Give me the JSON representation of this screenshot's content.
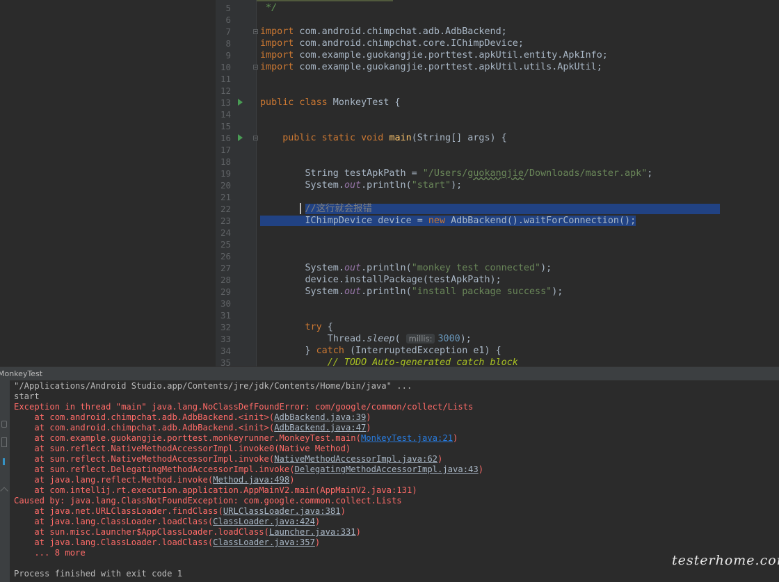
{
  "editor": {
    "lines": [
      {
        "num": "5",
        "html": "<span class=\"dcmt\"> */</span>"
      },
      {
        "num": "6",
        "html": ""
      },
      {
        "num": "7",
        "html": "<span class=\"kw\">import</span> com.android.chimpchat.adb.AdbBackend;",
        "fold": true
      },
      {
        "num": "8",
        "html": "<span class=\"kw\">import</span> com.android.chimpchat.core.IChimpDevice;"
      },
      {
        "num": "9",
        "html": "<span class=\"kw\">import</span> com.example.guokangjie.porttest.apkUtil.entity.ApkInfo;"
      },
      {
        "num": "10",
        "html": "<span class=\"kw\">import</span> com.example.guokangjie.porttest.apkUtil.utils.ApkUtil;",
        "fold": true
      },
      {
        "num": "11",
        "html": ""
      },
      {
        "num": "12",
        "html": ""
      },
      {
        "num": "13",
        "html": "<span class=\"kw\">public class</span> MonkeyTest {",
        "run": true
      },
      {
        "num": "14",
        "html": ""
      },
      {
        "num": "15",
        "html": ""
      },
      {
        "num": "16",
        "html": "    <span class=\"kw\">public static void</span> <span class=\"fn\">main</span>(String[] args) {",
        "run": true,
        "fold": true
      },
      {
        "num": "17",
        "html": ""
      },
      {
        "num": "18",
        "html": ""
      },
      {
        "num": "19",
        "html": "        String testApkPath = <span class=\"str\">\"/Users/<span class=\"squiggle\">guokangjie</span>/Downloads/master.apk\"</span>;"
      },
      {
        "num": "20",
        "html": "        System.<span class=\"fld\">out</span>.println(<span class=\"str\">\"start\"</span>);"
      },
      {
        "num": "21",
        "html": ""
      },
      {
        "num": "22",
        "html": "        <span class=\"sel\"><span class=\"cmt\">//这行就会报错</span>                                                              </span>",
        "selected": true
      },
      {
        "num": "23",
        "html": "<span class=\"sel\">        IChimpDevice device = <span class=\"kw\">new</span> AdbBackend().waitForConnection();</span>",
        "selected": true
      },
      {
        "num": "24",
        "html": ""
      },
      {
        "num": "25",
        "html": ""
      },
      {
        "num": "26",
        "html": ""
      },
      {
        "num": "27",
        "html": "        System.<span class=\"fld\">out</span>.println(<span class=\"str\">\"monkey test connected\"</span>);"
      },
      {
        "num": "28",
        "html": "        device.installPackage(testApkPath);"
      },
      {
        "num": "29",
        "html": "        System.<span class=\"fld\">out</span>.println(<span class=\"str\">\"install package success\"</span>);"
      },
      {
        "num": "30",
        "html": ""
      },
      {
        "num": "31",
        "html": ""
      },
      {
        "num": "32",
        "html": "        <span class=\"kw\">try</span> {"
      },
      {
        "num": "33",
        "html": "            Thread.<span class=\"static-m\">sleep</span>( <span class=\"hint\">millis:</span><span class=\"num\">3000</span>);"
      },
      {
        "num": "34",
        "html": "        } <span class=\"kw\">catch</span> (InterruptedException e1) {"
      },
      {
        "num": "35",
        "html": "            <span class=\"todo\">// TODO Auto-generated catch block</span>"
      }
    ]
  },
  "console": {
    "title": "MonkeyTest",
    "lines": [
      {
        "cls": "",
        "html": "\"/Applications/Android Studio.app/Contents/jre/jdk/Contents/Home/bin/java\" ..."
      },
      {
        "cls": "",
        "html": "start"
      },
      {
        "cls": "err",
        "html": "Exception in thread \"main\" java.lang.NoClassDefFoundError: com/google/common/collect/Lists"
      },
      {
        "cls": "err",
        "html": "    at com.android.chimpchat.adb.AdbBackend.&lt;init&gt;(<span class=\"lnk\">AdbBackend.java:39</span>)"
      },
      {
        "cls": "err",
        "html": "    at com.android.chimpchat.adb.AdbBackend.&lt;init&gt;(<span class=\"lnk\">AdbBackend.java:47</span>)"
      },
      {
        "cls": "err",
        "html": "    at com.example.guokangjie.porttest.monkeyrunner.MonkeyTest.main(<span class=\"lnk-blue\">MonkeyTest.java:21</span>)"
      },
      {
        "cls": "err",
        "html": "    at sun.reflect.NativeMethodAccessorImpl.invoke0(Native Method)"
      },
      {
        "cls": "err",
        "html": "    at sun.reflect.NativeMethodAccessorImpl.invoke(<span class=\"lnk\">NativeMethodAccessorImpl.java:62</span>)"
      },
      {
        "cls": "err",
        "html": "    at sun.reflect.DelegatingMethodAccessorImpl.invoke(<span class=\"lnk\">DelegatingMethodAccessorImpl.java:43</span>)"
      },
      {
        "cls": "err",
        "html": "    at java.lang.reflect.Method.invoke(<span class=\"lnk\">Method.java:498</span>)"
      },
      {
        "cls": "err",
        "html": "    at com.intellij.rt.execution.application.AppMainV2.main(AppMainV2.java:131)"
      },
      {
        "cls": "err",
        "html": "Caused by: java.lang.ClassNotFoundException: com.google.common.collect.Lists"
      },
      {
        "cls": "err",
        "html": "    at java.net.URLClassLoader.findClass(<span class=\"lnk\">URLClassLoader.java:381</span>)"
      },
      {
        "cls": "err",
        "html": "    at java.lang.ClassLoader.loadClass(<span class=\"lnk\">ClassLoader.java:424</span>)"
      },
      {
        "cls": "err",
        "html": "    at sun.misc.Launcher$AppClassLoader.loadClass(<span class=\"lnk\">Launcher.java:331</span>)"
      },
      {
        "cls": "err",
        "html": "    at java.lang.ClassLoader.loadClass(<span class=\"lnk\">ClassLoader.java:357</span>)"
      },
      {
        "cls": "err",
        "html": "    ... 8 more"
      },
      {
        "cls": "",
        "html": ""
      },
      {
        "cls": "",
        "html": "Process finished with exit code 1"
      }
    ]
  },
  "watermark": "testerhome.com",
  "colors": {
    "background": "#2b2b2b",
    "gutter": "#313335",
    "selection": "#214283",
    "error_text": "#ff6b68",
    "keyword": "#cc7832",
    "string": "#6a8759",
    "link_blue": "#287bde"
  }
}
